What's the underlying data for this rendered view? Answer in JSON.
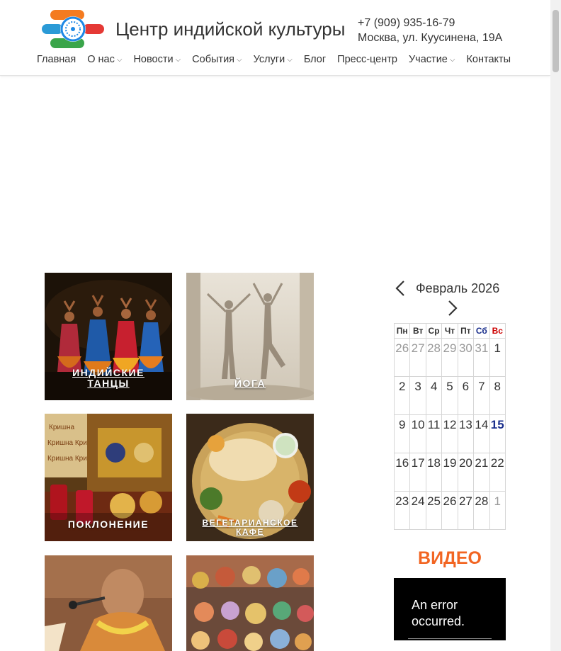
{
  "header": {
    "site_title": "Центр индийской культуры",
    "phone": "+7 (909) 935-16-79",
    "address": "Москва, ул. Куусинена, 19А"
  },
  "nav": {
    "items": [
      {
        "label": "Главная",
        "dropdown": false
      },
      {
        "label": "О нас",
        "dropdown": true
      },
      {
        "label": "Новости",
        "dropdown": true
      },
      {
        "label": "События",
        "dropdown": true
      },
      {
        "label": "Услуги",
        "dropdown": true
      },
      {
        "label": "Блог",
        "dropdown": false
      },
      {
        "label": "Пресс-центр",
        "dropdown": false
      },
      {
        "label": "Участие",
        "dropdown": true
      },
      {
        "label": "Контакты",
        "dropdown": false
      }
    ]
  },
  "tiles": [
    {
      "caption_line1": "ИНДИЙСКИЕ",
      "caption_line2": "ТАНЦЫ"
    },
    {
      "caption_line1": "ЙОГА",
      "caption_line2": ""
    },
    {
      "caption_line1": "ПОКЛОНЕНИЕ",
      "caption_line2": ""
    },
    {
      "caption_line1": "ВЕГЕТАРИАНСКОЕ",
      "caption_line2": "КАФЕ"
    },
    {
      "caption_line1": "",
      "caption_line2": ""
    },
    {
      "caption_line1": "",
      "caption_line2": ""
    }
  ],
  "tile_photo_text": {
    "krishna1": "Кришна",
    "krishna2": "Кришна Кришна",
    "krishna3": "Кришна Кришна"
  },
  "calendar": {
    "title": "Февраль 2026",
    "weekdays": [
      "Пн",
      "Вт",
      "Ср",
      "Чт",
      "Пт",
      "Сб",
      "Вс"
    ],
    "weeks": [
      [
        "26",
        "27",
        "28",
        "29",
        "30",
        "31",
        "1"
      ],
      [
        "2",
        "3",
        "4",
        "5",
        "6",
        "7",
        "8"
      ],
      [
        "9",
        "10",
        "11",
        "12",
        "13",
        "14",
        "15"
      ],
      [
        "16",
        "17",
        "18",
        "19",
        "20",
        "21",
        "22"
      ],
      [
        "23",
        "24",
        "25",
        "26",
        "27",
        "28",
        "1"
      ]
    ],
    "other_month": [
      [
        0,
        0
      ],
      [
        0,
        1
      ],
      [
        0,
        2
      ],
      [
        0,
        3
      ],
      [
        0,
        4
      ],
      [
        0,
        5
      ],
      [
        4,
        6
      ]
    ],
    "today": [
      2,
      6
    ],
    "colors": {
      "saturday": "#1a2f8c",
      "sunday": "#cc0000",
      "today": "#1a2f8c"
    }
  },
  "video": {
    "title": "ВИДЕО",
    "error_line1": "An error",
    "error_line2": "occurred."
  },
  "colors": {
    "accent_orange": "#f26522",
    "text": "#333333"
  }
}
